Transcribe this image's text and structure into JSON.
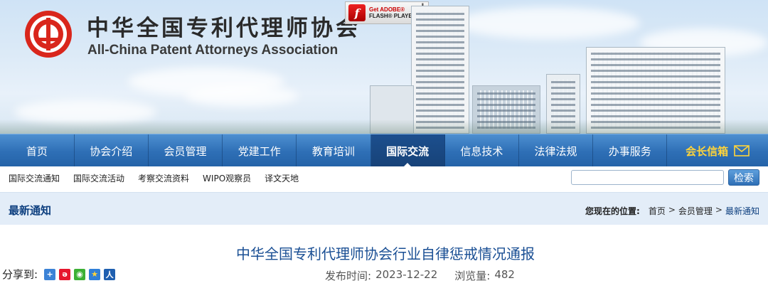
{
  "header": {
    "title_cn": "中华全国专利代理师协会",
    "title_en": "All-China Patent Attorneys Association",
    "flash_badge": {
      "line1": "Get ADOBE®",
      "line2": "FLASH® PLAYER"
    }
  },
  "nav": {
    "items": [
      {
        "label": "首页"
      },
      {
        "label": "协会介绍"
      },
      {
        "label": "会员管理"
      },
      {
        "label": "党建工作"
      },
      {
        "label": "教育培训"
      },
      {
        "label": "国际交流",
        "active": true
      },
      {
        "label": "信息技术"
      },
      {
        "label": "法律法规"
      },
      {
        "label": "办事服务"
      }
    ],
    "president_letter": "会长信箱",
    "active_color": "#174278",
    "bar_color": "#2e6fb6",
    "president_color": "#ffd43a"
  },
  "subnav": {
    "links": [
      "国际交流通知",
      "国际交流活动",
      "考察交流资料",
      "WIPO观察员",
      "译文天地"
    ],
    "search": {
      "value": "",
      "button_label": "检索"
    }
  },
  "section": {
    "title": "最新通知",
    "breadcrumb_label": "您现在的位置:",
    "breadcrumb": [
      "首页",
      "会员管理",
      "最新通知"
    ],
    "separator": ">"
  },
  "article": {
    "title": "中华全国专利代理师协会行业自律惩戒情况通报",
    "share_label": "分享到:",
    "share_icons": [
      "qzone-icon",
      "weibo-icon",
      "wechat-icon",
      "favorite-icon",
      "renren-icon"
    ],
    "publish_label": "发布时间:",
    "publish_date": "2023-12-22",
    "views_label": "浏览量:",
    "views": "482"
  }
}
